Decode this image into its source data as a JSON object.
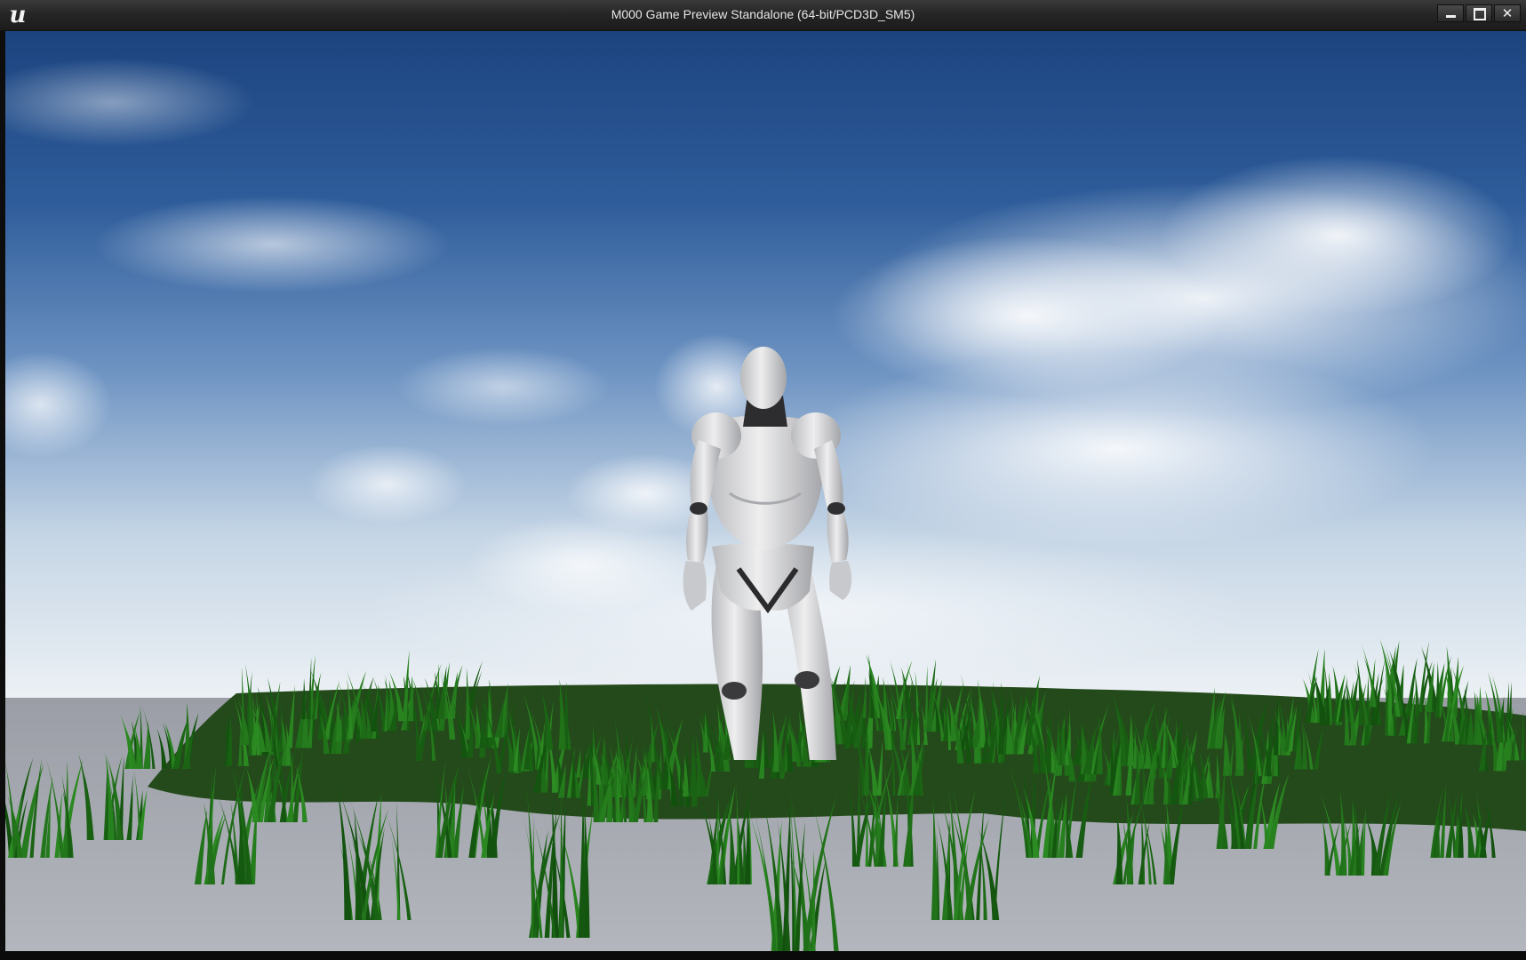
{
  "window": {
    "title": "M000 Game Preview Standalone (64-bit/PCD3D_SM5)",
    "logo_icon": "unreal-engine-logo-icon",
    "logo_glyph": "u",
    "controls": {
      "minimize_icon": "minimize-icon",
      "maximize_icon": "maximize-icon",
      "close_icon": "close-icon",
      "close_glyph": "✕"
    }
  },
  "scene": {
    "description_icon": "game-viewport",
    "colors": {
      "sky_top": "#1f4a8a",
      "sky_mid": "#5f88bd",
      "sky_horizon": "#e6edf3",
      "ground": "#a9adb5",
      "grass_dark": "#1f3d17",
      "grass_light": "#3f7a2c",
      "mannequin": "#d9dadc"
    }
  }
}
